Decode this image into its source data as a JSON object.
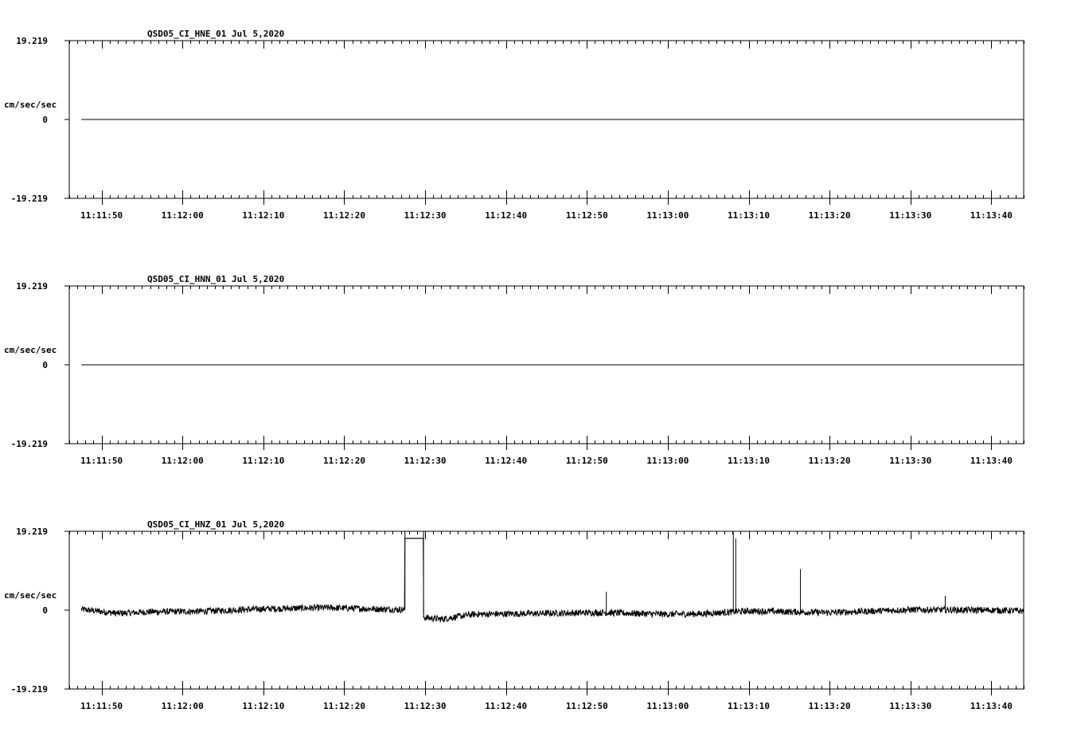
{
  "chart_data": [
    {
      "type": "line",
      "title": "QSD05_CI_HNE_01  Jul 5,2020",
      "ylabel": "cm/sec/sec",
      "ylim": [
        -19.219,
        19.219
      ],
      "ytick_labels": [
        "19.219",
        "0",
        "-19.219"
      ],
      "x_start_seconds": 46,
      "x_end_seconds": 164,
      "xtick_labels": [
        "11:11:50",
        "11:12:00",
        "11:12:10",
        "11:12:20",
        "11:12:30",
        "11:12:40",
        "11:12:50",
        "11:13:00",
        "11:13:10",
        "11:13:20",
        "11:13:30",
        "11:13:40"
      ],
      "trace": {
        "kind": "flat",
        "start": 47.5,
        "end": 164,
        "level": 0
      },
      "grid": false
    },
    {
      "type": "line",
      "title": "QSD05_CI_HNN_01  Jul 5,2020",
      "ylabel": "cm/sec/sec",
      "ylim": [
        -19.219,
        19.219
      ],
      "ytick_labels": [
        "19.219",
        "0",
        "-19.219"
      ],
      "x_start_seconds": 46,
      "x_end_seconds": 164,
      "xtick_labels": [
        "11:11:50",
        "11:12:00",
        "11:12:10",
        "11:12:20",
        "11:12:30",
        "11:12:40",
        "11:12:50",
        "11:13:00",
        "11:13:10",
        "11:13:20",
        "11:13:30",
        "11:13:40"
      ],
      "trace": {
        "kind": "flat",
        "start": 47.5,
        "end": 164,
        "level": 0
      },
      "grid": false
    },
    {
      "type": "line",
      "title": "QSD05_CI_HNZ_01  Jul 5,2020",
      "ylabel": "cm/sec/sec",
      "ylim": [
        -19.219,
        19.219
      ],
      "ytick_labels": [
        "19.219",
        "0",
        "-19.219"
      ],
      "x_start_seconds": 46,
      "x_end_seconds": 164,
      "xtick_labels": [
        "11:11:50",
        "11:12:00",
        "11:12:10",
        "11:12:20",
        "11:12:30",
        "11:12:40",
        "11:12:50",
        "11:13:00",
        "11:13:10",
        "11:13:20",
        "11:13:30",
        "11:13:40"
      ],
      "trace": {
        "kind": "noisy",
        "start": 47.5,
        "end": 164,
        "baseline_points": [
          [
            47.5,
            0.2
          ],
          [
            52,
            -0.8
          ],
          [
            56,
            -0.4
          ],
          [
            62,
            -0.3
          ],
          [
            70,
            0.3
          ],
          [
            78,
            0.6
          ],
          [
            87.5,
            0.1
          ],
          [
            90,
            -1.8
          ],
          [
            92,
            -2.2
          ],
          [
            96,
            -1.0
          ],
          [
            104,
            -0.8
          ],
          [
            112,
            -0.6
          ],
          [
            120,
            -1.0
          ],
          [
            124,
            -0.9
          ],
          [
            130,
            -0.2
          ],
          [
            140,
            -0.6
          ],
          [
            150,
            0.1
          ],
          [
            160,
            0.0
          ],
          [
            164,
            -0.2
          ]
        ],
        "boxes": [
          {
            "start": 87.5,
            "end": 89.8,
            "top": 17.5
          }
        ],
        "spikes": [
          {
            "t": 112.4,
            "peak": 4.5
          },
          {
            "t": 128.1,
            "peak": 19.0
          },
          {
            "t": 128.4,
            "peak": 17.5
          },
          {
            "t": 136.4,
            "peak": 10.0
          },
          {
            "t": 154.3,
            "peak": 3.5
          }
        ]
      },
      "grid": false
    }
  ]
}
